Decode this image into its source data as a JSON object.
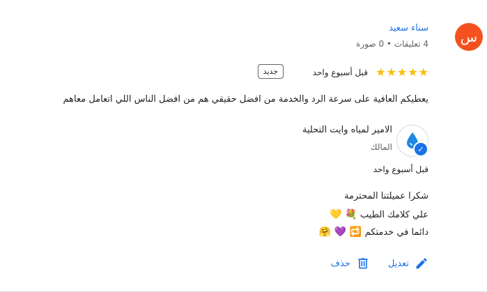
{
  "reviewer": {
    "avatar_letter": "س",
    "avatar_color": "#f4511e",
    "name": "سناء سعيد",
    "meta": "4 تعليقات • 0 صورة"
  },
  "review": {
    "rating": 5,
    "stars": [
      "★",
      "★",
      "★",
      "★",
      "★"
    ],
    "time": "قبل أسبوع واحد",
    "new_badge": "جديد",
    "text": "يعطيكم العافية على سرعة الرد والخدمة من افضل حقيقي هم من افضل الناس اللي اتعامل معاهم"
  },
  "owner": {
    "logo_icon": "water-drop-icon",
    "name": "الامير لمياه وايت التحلية",
    "role": "المالك",
    "reply_time": "قبل أسبوع واحد",
    "reply_lines": [
      {
        "text": "شكرا عميلتنا المحترمة",
        "emojis": []
      },
      {
        "text": "علي كلامك الطيب",
        "emojis": [
          "💐",
          "💛"
        ]
      },
      {
        "text": "دائما في خدمتكم",
        "emojis": [
          "🔁",
          "💜",
          "🤗"
        ]
      }
    ]
  },
  "actions": {
    "edit_label": "تعديل",
    "delete_label": "حذف"
  },
  "colors": {
    "accent": "#1a73e8",
    "star": "#fbbc04",
    "muted": "#5f6368"
  }
}
